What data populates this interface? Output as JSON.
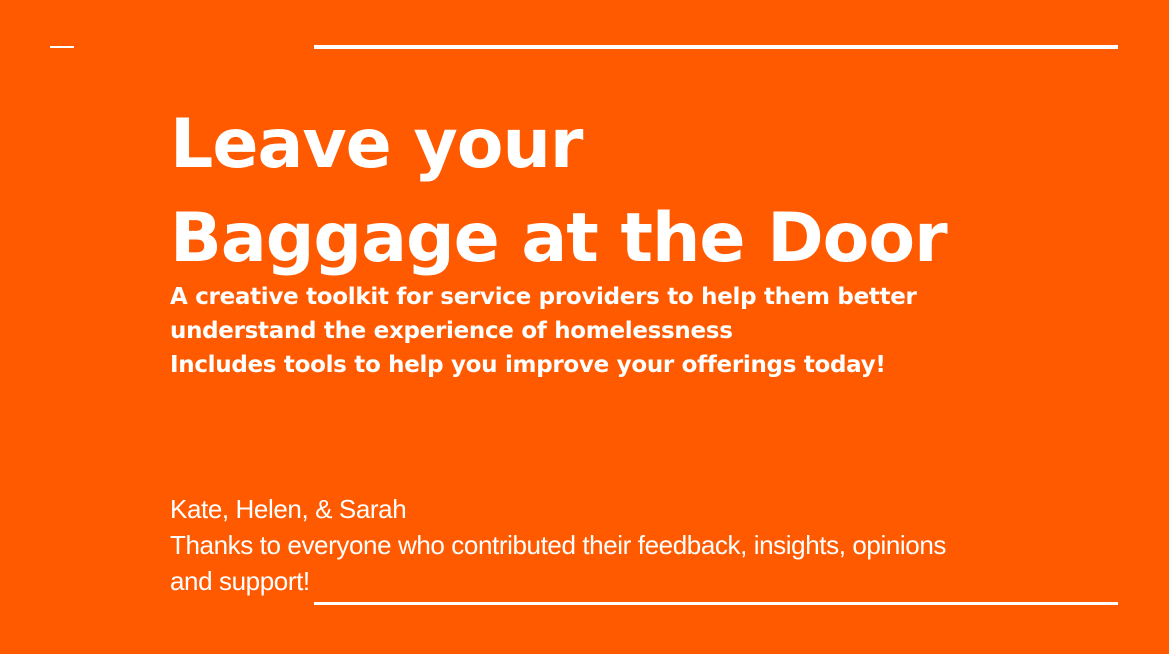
{
  "slide": {
    "background_color": "#FF5A00",
    "title_lines": [
      "Leave your",
      "Baggage at the Door"
    ],
    "subtitle_lines": [
      "A creative toolkit for service providers to help them better",
      "understand the experience of homelessness",
      "Includes tools to help you improve your offerings today!"
    ],
    "credits_lines": [
      "Kate, Helen, & Sarah",
      "Thanks to everyone who contributed their feedback, insights, opinions",
      "and support!"
    ]
  }
}
